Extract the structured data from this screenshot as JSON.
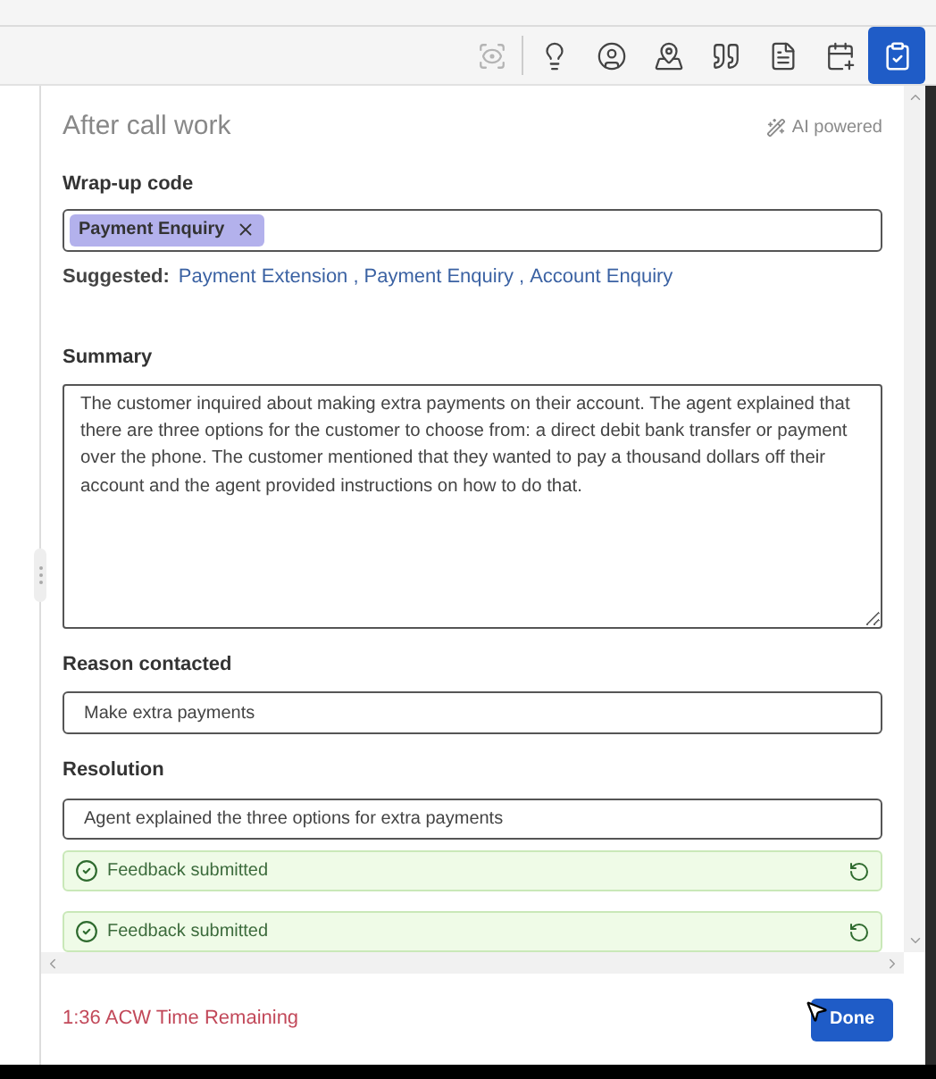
{
  "toolbar": [
    {
      "disabled": true,
      "selected": false
    },
    {
      "disabled": false,
      "selected": false
    },
    {
      "disabled": false,
      "selected": false
    },
    {
      "disabled": false,
      "selected": false
    },
    {
      "disabled": false,
      "selected": false
    },
    {
      "disabled": false,
      "selected": false
    },
    {
      "disabled": false,
      "selected": false
    },
    {
      "disabled": false,
      "selected": true
    }
  ],
  "panel": {
    "title": "After call work",
    "ai_badge": "AI powered",
    "wrapup": {
      "label": "Wrap-up code",
      "chips": [
        "Payment Enquiry"
      ],
      "suggested_label": "Suggested:",
      "suggestions": [
        "Payment Extension",
        "Payment Enquiry",
        "Account Enquiry"
      ],
      "separator": ","
    },
    "summary": {
      "label": "Summary",
      "value": "The customer inquired about making extra payments on their account. The agent explained that there are three options for the customer to choose from: a direct debit bank transfer or payment over the phone. The customer mentioned that they wanted to pay a thousand dollars off their account and the agent provided instructions on how to do that."
    },
    "reason": {
      "label": "Reason contacted",
      "value": "Make extra payments"
    },
    "resolution": {
      "label": "Resolution",
      "value": "Agent explained the three options for extra payments"
    },
    "feedback": [
      {
        "text": "Feedback submitted"
      },
      {
        "text": "Feedback submitted"
      }
    ]
  },
  "footer": {
    "timer": "1:36 ACW Time Remaining",
    "done": "Done"
  }
}
